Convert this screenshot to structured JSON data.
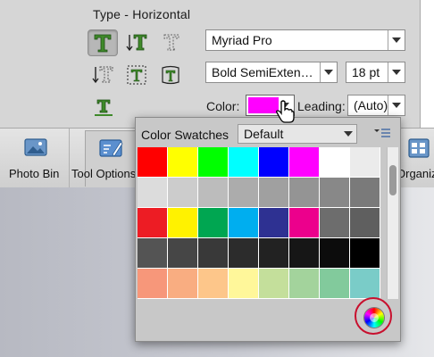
{
  "type_panel": {
    "header": "Type - Horizontal",
    "font_family": "Myriad Pro",
    "font_style": "Bold SemiExten…",
    "font_size": "18 pt",
    "color_label": "Color:",
    "color_value": "#ff00ff",
    "leading_label": "Leading:",
    "leading_value": "(Auto)"
  },
  "bottom_bar": {
    "photo_bin_label": "Photo Bin",
    "tool_options_label": "Tool Options",
    "organizer_label": "Organizer"
  },
  "swatches": {
    "title": "Color Swatches",
    "library": "Default",
    "colors": [
      "#ff0000",
      "#ffff00",
      "#00ff00",
      "#00ffff",
      "#0000ff",
      "#ff00ff",
      "#ffffff",
      "#ebebeb",
      "#dcdcdc",
      "#cccccc",
      "#bcbcbc",
      "#acacac",
      "#a0a0a0",
      "#949494",
      "#888888",
      "#7a7a7a",
      "#ed1c24",
      "#fff200",
      "#00a651",
      "#00aeef",
      "#2e3192",
      "#ec008c",
      "#6d6d6d",
      "#5f5f5f",
      "#545454",
      "#464646",
      "#393939",
      "#2c2c2c",
      "#222222",
      "#161616",
      "#0c0c0c",
      "#000000",
      "#f7977a",
      "#f9ad81",
      "#fdc68a",
      "#fff79a",
      "#c4df9b",
      "#a3d39c",
      "#82ca9c",
      "#7accc8"
    ]
  }
}
